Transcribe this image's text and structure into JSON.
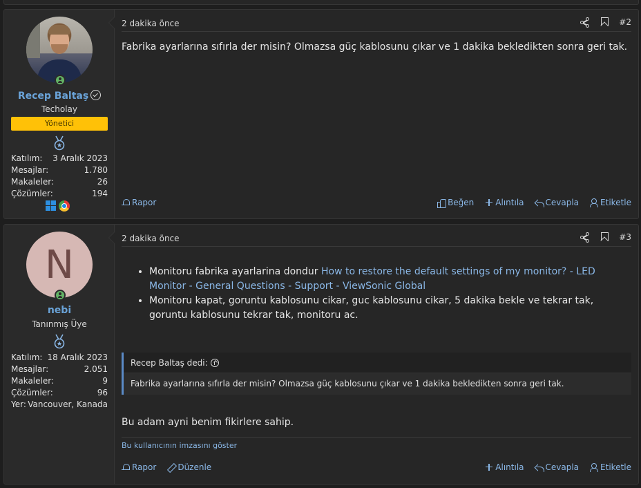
{
  "posts": [
    {
      "user": {
        "name": "Recep Baltaş",
        "title": "Techolay",
        "role": "Yönetici",
        "stats": [
          {
            "label": "Katılım:",
            "value": "3 Aralık 2023"
          },
          {
            "label": "Mesajlar:",
            "value": "1.780"
          },
          {
            "label": "Makaleler:",
            "value": "26"
          },
          {
            "label": "Çözümler:",
            "value": "194"
          }
        ]
      },
      "time": "2 dakika önce",
      "number": "#2",
      "message": "Fabrika ayarlarına sıfırla der misin? Olmazsa güç kablosunu çıkar ve 1 dakika bekledikten sonra geri tak.",
      "footer": {
        "report": "Rapor",
        "like": "Beğen",
        "quote": "Alıntıla",
        "reply": "Cevapla",
        "tag": "Etiketle"
      }
    },
    {
      "user": {
        "avatar_letter": "N",
        "name": "nebi",
        "title": "Tanınmış Üye",
        "stats": [
          {
            "label": "Katılım:",
            "value": "18 Aralık 2023"
          },
          {
            "label": "Mesajlar:",
            "value": "2.051"
          },
          {
            "label": "Makaleler:",
            "value": "9"
          },
          {
            "label": "Çözümler:",
            "value": "96"
          },
          {
            "label": "Yer:",
            "value": "Vancouver, Kanada"
          }
        ]
      },
      "time": "2 dakika önce",
      "number": "#3",
      "list": {
        "item1_text": "Monitoru fabrika ayarlarina dondur ",
        "item1_link": "How to restore the default settings of my monitor? - LED Monitor - General Questions - Support - ViewSonic Global",
        "item2_text": "Monitoru kapat, goruntu kablosunu cikar, guc kablosunu cikar, 5 dakika bekle ve tekrar tak, goruntu kablosunu tekrar tak, monitoru ac."
      },
      "quote": {
        "author": "Recep Baltaş dedi:",
        "text": "Fabrika ayarlarına sıfırla der misin? Olmazsa güç kablosunu çıkar ve 1 dakika bekledikten sonra geri tak."
      },
      "message": "Bu adam ayni benim fikirlere sahip.",
      "signature_link": "Bu kullanıcının imzasını göster",
      "footer": {
        "report": "Rapor",
        "edit": "Düzenle",
        "quote": "Alıntıla",
        "reply": "Cevapla",
        "tag": "Etiketle"
      }
    }
  ],
  "colors": {
    "background": "#1e1e1e",
    "panel": "#262626",
    "link": "#8ab7e6",
    "username": "#6aa3d8",
    "role_badge": "#ffc107",
    "online": "#63b365"
  }
}
